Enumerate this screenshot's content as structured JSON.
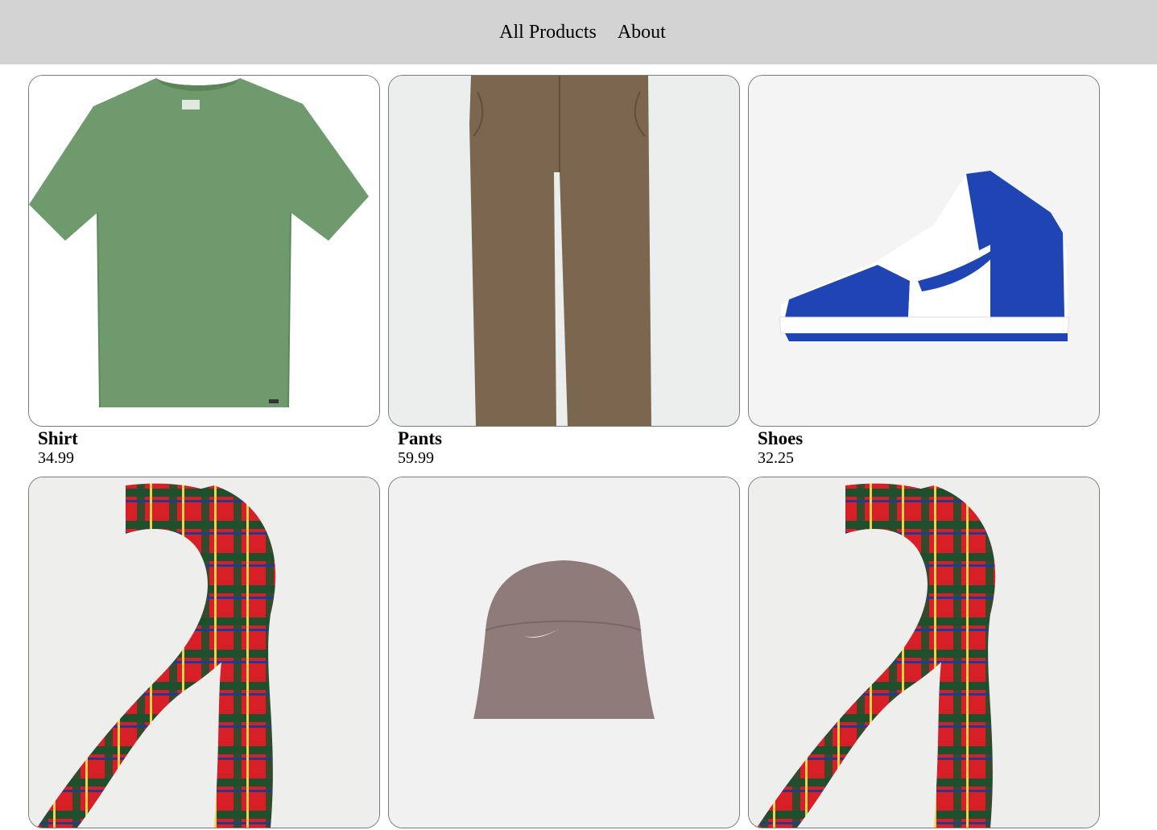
{
  "nav": {
    "links": [
      {
        "label": "All Products"
      },
      {
        "label": "About"
      }
    ]
  },
  "products": [
    {
      "name": "Shirt",
      "price": "34.99",
      "image": "green-tshirt",
      "bg": "#ffffff"
    },
    {
      "name": "Pants",
      "price": "59.99",
      "image": "brown-chino-pants",
      "bg": "#eceded"
    },
    {
      "name": "Shoes",
      "price": "32.25",
      "image": "blue-white-high-top-sneaker",
      "bg": "#f4f4f4"
    },
    {
      "name": "",
      "price": "",
      "image": "red-plaid-scarf",
      "bg": "#eeeeec"
    },
    {
      "name": "",
      "price": "",
      "image": "mauve-bucket-hat",
      "bg": "#f1f1f1"
    },
    {
      "name": "",
      "price": "",
      "image": "red-plaid-scarf",
      "bg": "#eeeeec"
    }
  ]
}
